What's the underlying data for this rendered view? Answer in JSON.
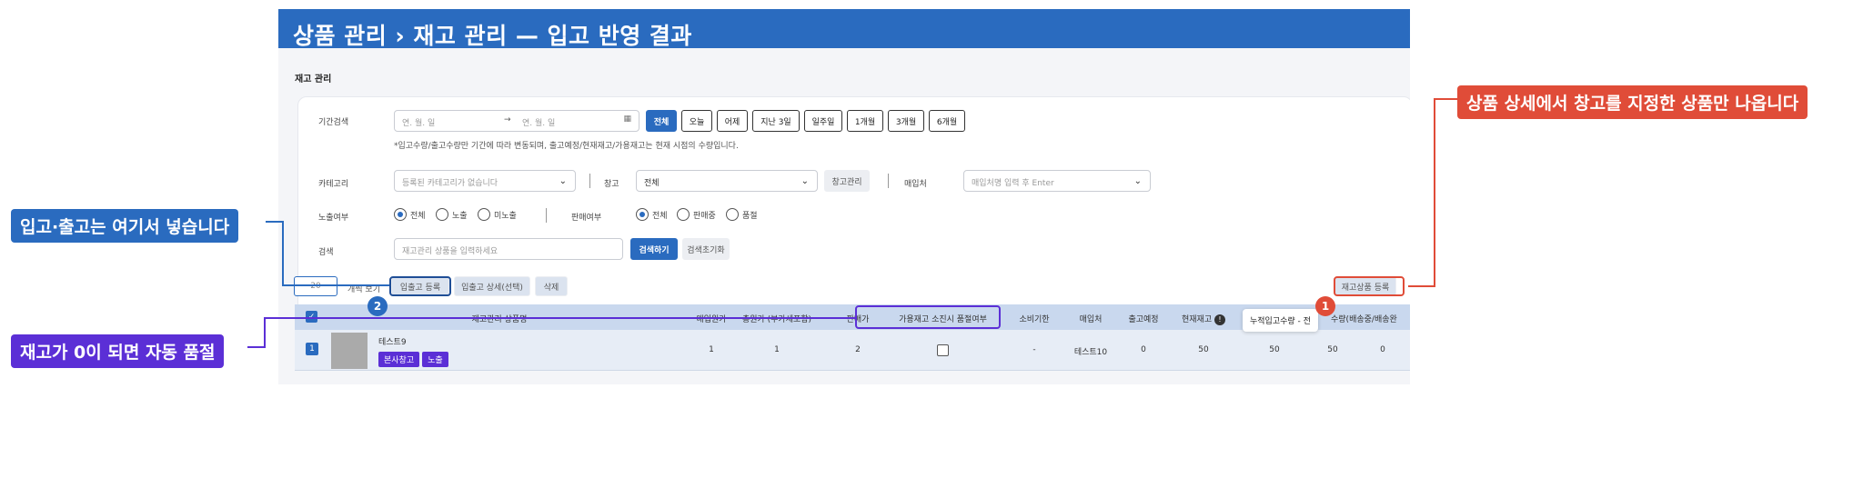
{
  "banner": {
    "title": "상품 관리 › 재고 관리 — 입고 반영 결과"
  },
  "section_title": "재고 관리",
  "filters": {
    "period_label": "기간검색",
    "date_start_placeholder": "연. 월. 일",
    "date_arrow": "→",
    "date_end_placeholder": "연. 월. 일",
    "period_buttons": [
      "전체",
      "오늘",
      "어제",
      "지난 3일",
      "일주일",
      "1개월",
      "3개월",
      "6개월"
    ],
    "note": "*입고수량/출고수량만 기간에 따라 변동되며, 출고예정/현재재고/가용재고는 현재 시점의 수량입니다.",
    "category_label": "카테고리",
    "category_placeholder": "등록된 카테고리가 없습니다",
    "warehouse_label": "창고",
    "warehouse_value": "전체",
    "warehouse_manage_button": "창고관리",
    "supplier_label": "매입처",
    "supplier_placeholder": "매입처명 입력 후 Enter",
    "exposure_label": "노출여부",
    "exposure_options": [
      "전체",
      "노출",
      "미노출"
    ],
    "sale_label": "판매여부",
    "sale_options": [
      "전체",
      "판매중",
      "품절"
    ],
    "search_label": "검색",
    "search_placeholder": "재고관리 상품을 입력하세요",
    "search_button": "검색하기",
    "reset_button": "검색초기화"
  },
  "actions": {
    "page_size": "20",
    "page_size_suffix": "개씩 보기",
    "inout_register": "입출고 등록",
    "inout_detail": "입출고 상세(선택)",
    "delete": "삭제",
    "stock_register": "재고상품 등록"
  },
  "table": {
    "headers": [
      "재고관리 상품명",
      "매입원가",
      "총원가 (부가세포함)",
      "판매가",
      "가용재고 소진시 품절여부",
      "소비기한",
      "매입처",
      "출고예정",
      "현재재고",
      "누적입고수량",
      "수량(배송중/배송완"
    ],
    "row": {
      "num": "1",
      "name": "테스트9",
      "tags": [
        "본사창고",
        "노출"
      ],
      "cost": "1",
      "total_cost": "1",
      "price": "2",
      "expiry": "-",
      "supplier": "테스트10",
      "scheduled": "0",
      "stock": "50",
      "cumulative_in": "50",
      "col_qty": "50",
      "col_last": "0"
    },
    "tooltip": "누적입고수량 - 전"
  },
  "callouts": {
    "red": "상품 상세에서 창고를 지정한 상품만 나옵니다",
    "blue": "입고·출고는 여기서 넣습니다",
    "purple": "재고가 0이 되면 자동 품절",
    "badge1": "1",
    "badge2": "2"
  },
  "colors": {
    "brand_blue": "#2a6bbf",
    "callout_red": "#e04c38",
    "callout_purple": "#5b2fd6"
  }
}
